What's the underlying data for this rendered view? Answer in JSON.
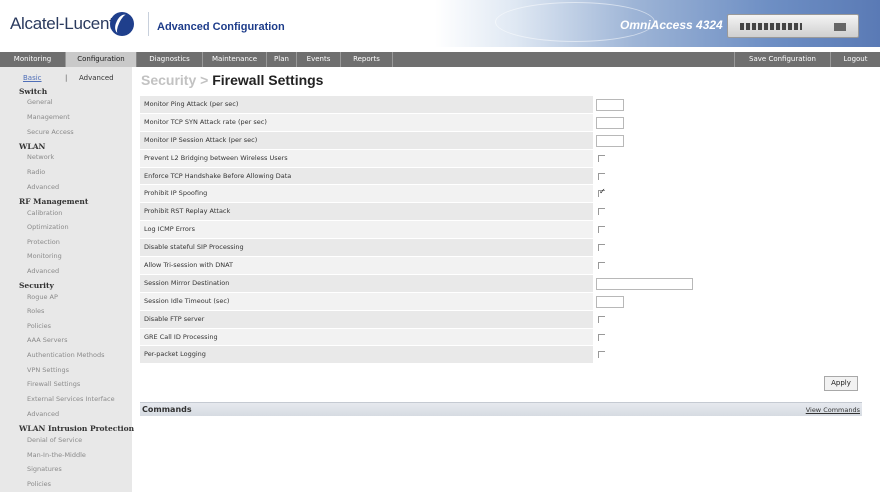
{
  "header": {
    "brand": "Alcatel-Lucent",
    "app_title": "Advanced Configuration",
    "product": "OmniAccess 4324"
  },
  "nav": {
    "tabs": [
      {
        "label": "Monitoring"
      },
      {
        "label": "Configuration"
      },
      {
        "label": "Diagnostics"
      },
      {
        "label": "Maintenance"
      },
      {
        "label": "Plan"
      },
      {
        "label": "Events"
      },
      {
        "label": "Reports"
      }
    ],
    "active_tab": "Configuration",
    "save_label": "Save Configuration",
    "logout_label": "Logout"
  },
  "sidebar": {
    "basic_label": "Basic",
    "separator": "|",
    "advanced_label": "Advanced",
    "sections": [
      {
        "title": "Switch",
        "items": [
          "General",
          "Management",
          "Secure Access"
        ]
      },
      {
        "title": "WLAN",
        "items": [
          "Network",
          "Radio",
          "Advanced"
        ]
      },
      {
        "title": "RF Management",
        "items": [
          "Calibration",
          "Optimization",
          "Protection",
          "Monitoring",
          "Advanced"
        ]
      },
      {
        "title": "Security",
        "items": [
          "Rogue AP",
          "Roles",
          "Policies",
          "AAA Servers",
          "Authentication Methods",
          "VPN Settings",
          "Firewall Settings",
          "External Services Interface",
          "Advanced"
        ]
      },
      {
        "title": "WLAN Intrusion Protection",
        "items": [
          "Denial of Service",
          "Man-In-the-Middle",
          "Signatures",
          "Policies"
        ]
      }
    ]
  },
  "page": {
    "breadcrumb": "Security >",
    "title": "Firewall Settings"
  },
  "settings": [
    {
      "label": "Monitor Ping Attack (per sec)",
      "control": "text",
      "value": ""
    },
    {
      "label": "Monitor TCP SYN Attack rate (per sec)",
      "control": "text",
      "value": ""
    },
    {
      "label": "Monitor IP Session Attack (per sec)",
      "control": "text",
      "value": ""
    },
    {
      "label": "Prevent L2 Bridging between Wireless Users",
      "control": "checkbox",
      "checked": false
    },
    {
      "label": "Enforce TCP Handshake Before Allowing Data",
      "control": "checkbox",
      "checked": false
    },
    {
      "label": "Prohibit IP Spoofing",
      "control": "checkbox",
      "checked": true
    },
    {
      "label": "Prohibit RST Replay Attack",
      "control": "checkbox",
      "checked": false
    },
    {
      "label": "Log ICMP Errors",
      "control": "checkbox",
      "checked": false
    },
    {
      "label": "Disable stateful SIP Processing",
      "control": "checkbox",
      "checked": false
    },
    {
      "label": "Allow Tri-session with DNAT",
      "control": "checkbox",
      "checked": false
    },
    {
      "label": "Session Mirror Destination",
      "control": "text-wide",
      "value": ""
    },
    {
      "label": "Session Idle Timeout (sec)",
      "control": "text",
      "value": ""
    },
    {
      "label": "Disable FTP server",
      "control": "checkbox",
      "checked": false
    },
    {
      "label": "GRE Call ID Processing",
      "control": "checkbox",
      "checked": false
    },
    {
      "label": "Per-packet Logging",
      "control": "checkbox",
      "checked": false
    }
  ],
  "apply_label": "Apply",
  "commands": {
    "title": "Commands",
    "link": "View Commands"
  }
}
